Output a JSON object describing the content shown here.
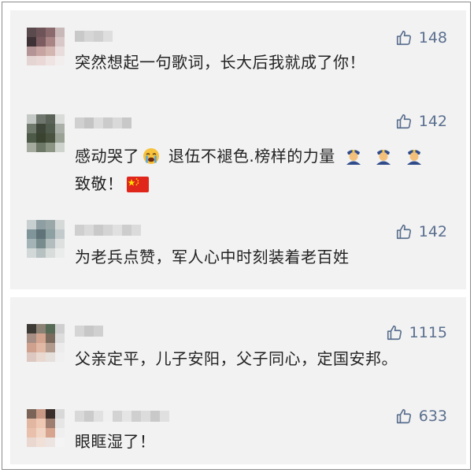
{
  "colors": {
    "panel_bg": "#f2f2f2",
    "like_color": "#5a6f8f",
    "text_color": "#222222"
  },
  "comments": [
    {
      "likes": "148",
      "text": "突然想起一句歌词，长大后我就成了你！"
    },
    {
      "likes": "142",
      "text_line1": "感动哭了",
      "text_line1b": "退伍不褪色.榜样的力量",
      "text_line2": "致敬！",
      "emoji": [
        "crying-face",
        "police-officer",
        "police-officer",
        "police-officer",
        "china-flag"
      ]
    },
    {
      "likes": "142",
      "text": "为老兵点赞，军人心中时刻装着老百姓"
    },
    {
      "likes": "1115",
      "text": "父亲定平，儿子安阳，父子同心，定国安邦。"
    },
    {
      "likes": "633",
      "text": "眼眶湿了！"
    }
  ],
  "icons": {
    "like": "thumbs-up-icon"
  }
}
